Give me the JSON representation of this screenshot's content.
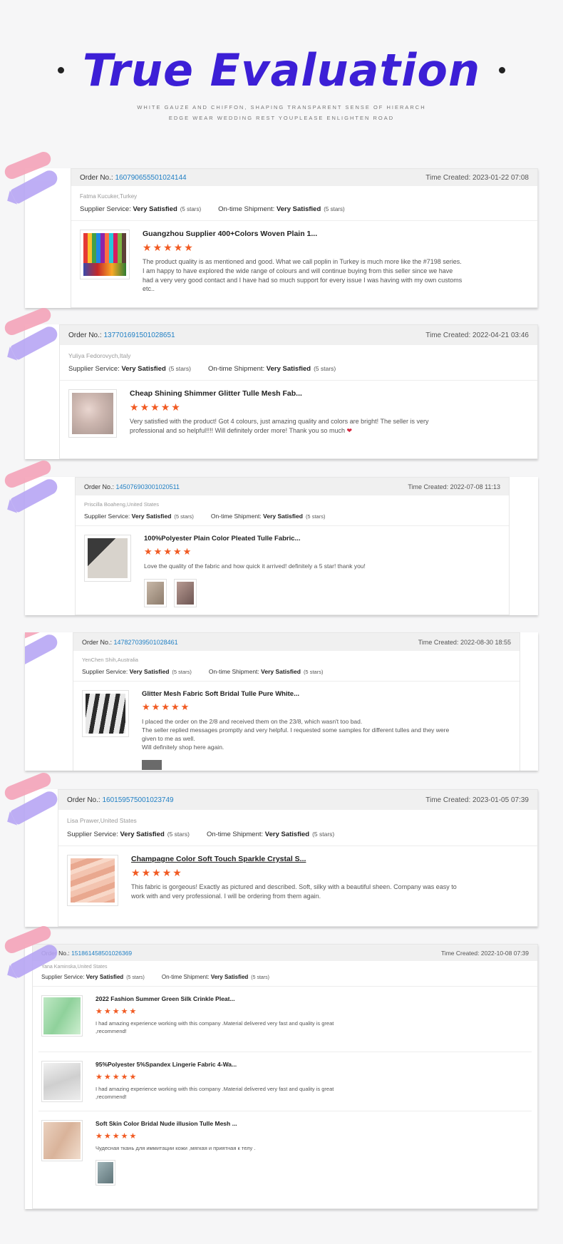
{
  "header": {
    "title": "True Evaluation",
    "subtitle_line1": "WHITE GAUZE AND CHIFFON, SHAPING TRANSPARENT SENSE OF HIERARCH",
    "subtitle_line2": "EDGE WEAR WEDDING REST YOUPLEASE ENLIGHTEN ROAD"
  },
  "labels": {
    "order_no": "Order No.:",
    "time_created": "Time Created:",
    "supplier_service": "Supplier Service:",
    "on_time_shipment": "On-time Shipment:",
    "very_satisfied": "Very Satisfied",
    "five_stars": "(5 stars)",
    "star": "★"
  },
  "colors": {
    "title": "#3c1fd6",
    "order_link": "#1f7fc4",
    "star": "#f15a22"
  },
  "reviews": [
    {
      "order_number": "1607906555010241 44",
      "order_display": "160790655501024144",
      "time": "2023-01-22 07:08",
      "buyer": "Fatma Kucuker,Turkey",
      "product": "Guangzhou Supplier 400+Colors Woven Plain 1...",
      "image_icon": "colorful-fabric-swatches",
      "text": "The product quality is as mentioned and good.  What we call poplin in Turkey is much more like the #7198 series. I am happy to have explored the wide range of colours and will continue buying from this seller since we have had a very very good contact and I have had so much support for every issue I was having with my own customs etc.."
    },
    {
      "order_display": "137701691501028651",
      "time": "2022-04-21 03:46",
      "buyer": "Yuliya Fedorovych,Italy",
      "product": "Cheap Shining Shimmer Glitter Tulle Mesh Fab...",
      "image_icon": "glitter-tulle-hand",
      "text": "Very satisfied with the product! Got 4 colours, just amazing quality and colors are bright! The seller is very professional and so helpful!!!! Will definitely order more! Thank you so much",
      "heart": "❤"
    },
    {
      "order_display": "145076903001020511",
      "time": "2022-07-08 11:13",
      "buyer": "Priscilla Boaheng,United States",
      "product": "100%Polyester Plain Color Pleated Tulle Fabric...",
      "image_icon": "pleated-tulle-bouquet",
      "text": "Love the quality of the fabric and how quick it arrived! definitely a 5 star! thank you!"
    },
    {
      "order_display": "147827039501028461",
      "time": "2022-08-30 18:55",
      "buyer": "YenChen Shih,Australia",
      "product": "Glitter Mesh Fabric Soft Bridal Tulle Pure White...",
      "image_icon": "white-glitter-mesh",
      "text_lines": [
        "I placed the order on the 2/8 and received them on the 23/8, which wasn't too bad.",
        "The seller replied messages promptly and very helpful. I requested some samples for different tulles and they were given to me as well.",
        "Will definitely shop here again."
      ]
    },
    {
      "order_display": "160159575001023749",
      "time": "2023-01-05 07:39",
      "buyer": "Lisa Prawer,United States",
      "product": "Champagne Color Soft Touch Sparkle Crystal S...",
      "image_icon": "champagne-satin-fabric",
      "text": "This fabric is gorgeous! Exactly as pictured and described. Soft, silky with a beautiful sheen. Company was easy to work with and very professional. I will be ordering from them again."
    },
    {
      "order_display": "151861458501026369",
      "time": "2022-10-08 07:39",
      "buyer": "Yana Kaminska,United States",
      "items": [
        {
          "product": "2022 Fashion Summer Green Silk Crinkle Pleat...",
          "image_icon": "green-silk-dress",
          "text": "I had amazing experience working with this company .Material delivered very fast and quality is great ,recommend!"
        },
        {
          "product": "95%Polyester 5%Spandex Lingerie Fabric 4-Wa...",
          "image_icon": "white-lingerie-fabric",
          "text": "I had amazing experience working with this company .Material delivered very fast and quality is great ,recommend!"
        },
        {
          "product": "Soft Skin Color Bridal Nude illusion Tulle Mesh ...",
          "image_icon": "skin-tulle-hand",
          "text": "Чудесная ткань для иммитации кожи ,мягкая и приятная к телу ."
        }
      ]
    }
  ]
}
